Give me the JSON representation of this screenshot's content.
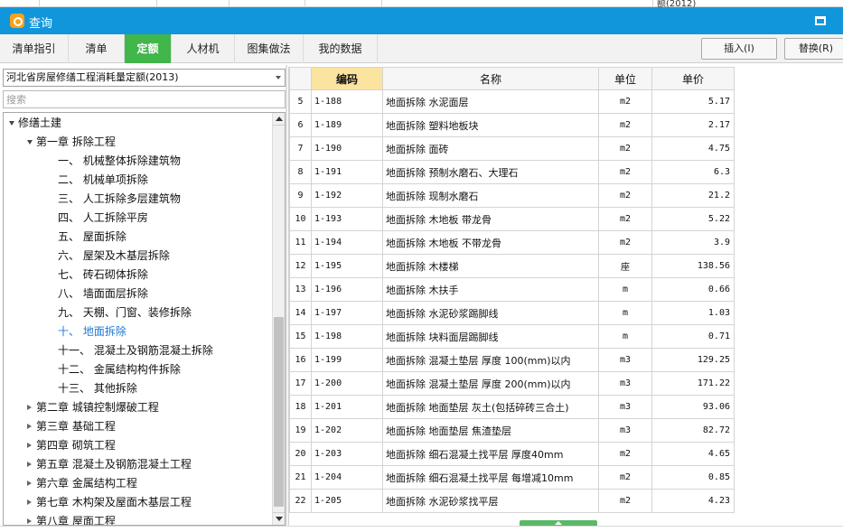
{
  "background": {
    "peek_text": "额(2012)"
  },
  "window": {
    "title": "查询",
    "accent": "#1296db",
    "icon": "app-icon",
    "maximize_icon": "maximize-icon"
  },
  "tabs": [
    {
      "label": "清单指引",
      "active": false
    },
    {
      "label": "清单",
      "active": false
    },
    {
      "label": "定额",
      "active": true
    },
    {
      "label": "人材机",
      "active": false
    },
    {
      "label": "图集做法",
      "active": false
    },
    {
      "label": "我的数据",
      "active": false
    }
  ],
  "toolbar": {
    "insert_label": "插入(I)",
    "replace_label": "替换(R)"
  },
  "left": {
    "quota_book": "河北省房屋修缮工程消耗量定额(2013)",
    "search_placeholder": "搜索",
    "tree": [
      {
        "label": "修缮土建",
        "level": 0,
        "toggle": "expanded"
      },
      {
        "label": "第一章 拆除工程",
        "level": 1,
        "toggle": "expanded"
      },
      {
        "label": "一、 机械整体拆除建筑物",
        "level": 2
      },
      {
        "label": "二、 机械单项拆除",
        "level": 2
      },
      {
        "label": "三、 人工拆除多层建筑物",
        "level": 2
      },
      {
        "label": "四、 人工拆除平房",
        "level": 2
      },
      {
        "label": "五、 屋面拆除",
        "level": 2
      },
      {
        "label": "六、 屋架及木基层拆除",
        "level": 2
      },
      {
        "label": "七、 砖石砌体拆除",
        "level": 2
      },
      {
        "label": "八、 墙面面层拆除",
        "level": 2
      },
      {
        "label": "九、 天棚、门窗、装修拆除",
        "level": 2
      },
      {
        "label": "十、 地面拆除",
        "level": 2,
        "selected": true
      },
      {
        "label": "十一、 混凝土及钢筋混凝土拆除",
        "level": 2
      },
      {
        "label": "十二、 金属结构构件拆除",
        "level": 2
      },
      {
        "label": "十三、 其他拆除",
        "level": 2
      },
      {
        "label": "第二章 城镇控制爆破工程",
        "level": 1,
        "toggle": "collapsed"
      },
      {
        "label": "第三章 基础工程",
        "level": 1,
        "toggle": "collapsed"
      },
      {
        "label": "第四章 砌筑工程",
        "level": 1,
        "toggle": "collapsed"
      },
      {
        "label": "第五章 混凝土及钢筋混凝土工程",
        "level": 1,
        "toggle": "collapsed"
      },
      {
        "label": "第六章 金属结构工程",
        "level": 1,
        "toggle": "collapsed"
      },
      {
        "label": "第七章 木构架及屋面木基层工程",
        "level": 1,
        "toggle": "collapsed"
      },
      {
        "label": "第八章 屋面工程",
        "level": 1,
        "toggle": "collapsed"
      }
    ]
  },
  "table": {
    "columns": [
      "",
      "编码",
      "名称",
      "单位",
      "单价"
    ],
    "sorted_column": "编码",
    "rows": [
      [
        "5",
        "1-188",
        "地面拆除 水泥面层",
        "m2",
        "5.17"
      ],
      [
        "6",
        "1-189",
        "地面拆除 塑料地板块",
        "m2",
        "2.17"
      ],
      [
        "7",
        "1-190",
        "地面拆除 面砖",
        "m2",
        "4.75"
      ],
      [
        "8",
        "1-191",
        "地面拆除 预制水磨石、大理石",
        "m2",
        "6.3"
      ],
      [
        "9",
        "1-192",
        "地面拆除 现制水磨石",
        "m2",
        "21.2"
      ],
      [
        "10",
        "1-193",
        "地面拆除 木地板 带龙骨",
        "m2",
        "5.22"
      ],
      [
        "11",
        "1-194",
        "地面拆除 木地板 不带龙骨",
        "m2",
        "3.9"
      ],
      [
        "12",
        "1-195",
        "地面拆除 木楼梯",
        "座",
        "138.56"
      ],
      [
        "13",
        "1-196",
        "地面拆除 木扶手",
        "m",
        "0.66"
      ],
      [
        "14",
        "1-197",
        "地面拆除 水泥砂浆踢脚线",
        "m",
        "1.03"
      ],
      [
        "15",
        "1-198",
        "地面拆除 块料面层踢脚线",
        "m",
        "0.71"
      ],
      [
        "16",
        "1-199",
        "地面拆除 混凝土垫层 厚度 100(mm)以内",
        "m3",
        "129.25"
      ],
      [
        "17",
        "1-200",
        "地面拆除 混凝土垫层 厚度 200(mm)以内",
        "m3",
        "171.22"
      ],
      [
        "18",
        "1-201",
        "地面拆除 地面垫层 灰土(包括碎砖三合土)",
        "m3",
        "93.06"
      ],
      [
        "19",
        "1-202",
        "地面拆除 地面垫层 焦渣垫层",
        "m3",
        "82.72"
      ],
      [
        "20",
        "1-203",
        "地面拆除 细石混凝土找平层 厚度40mm",
        "m2",
        "4.65"
      ],
      [
        "21",
        "1-204",
        "地面拆除 细石混凝土找平层 每增减10mm",
        "m2",
        "0.85"
      ],
      [
        "22",
        "1-205",
        "地面拆除 水泥砂浆找平层",
        "m2",
        "4.23"
      ]
    ]
  }
}
